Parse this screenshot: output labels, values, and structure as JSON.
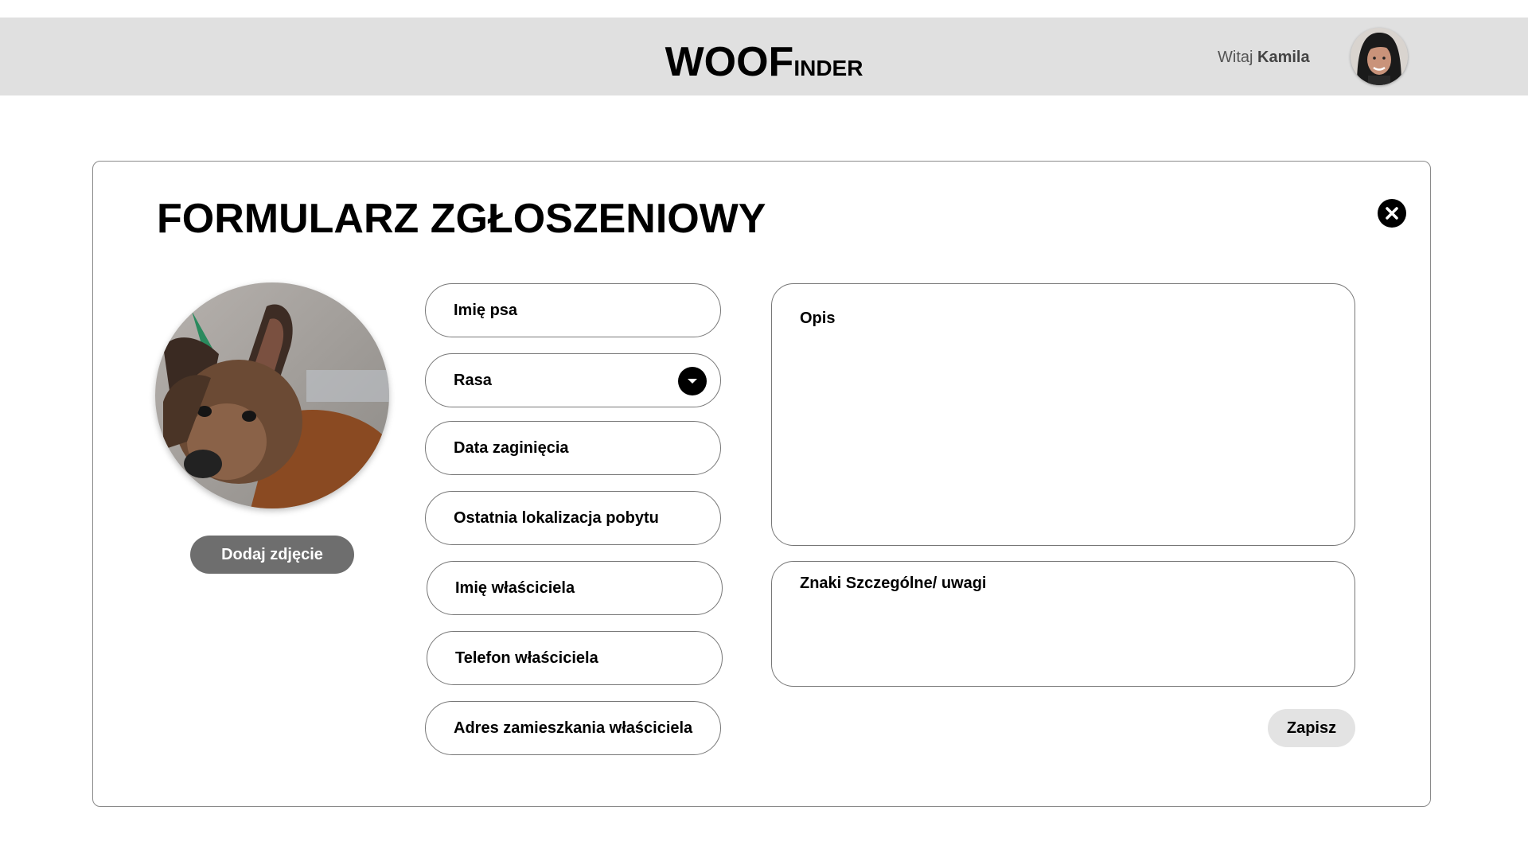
{
  "header": {
    "logo_main": "WOOF",
    "logo_rest": "INDER",
    "greeting_prefix": "Witaj",
    "user_name": "Kamila",
    "avatar_icon": "user-avatar-photo"
  },
  "form": {
    "title": "FORMULARZ ZGŁOSZENIOWY",
    "close_icon": "close-icon",
    "photo_icon": "dog-photo",
    "add_photo_label": "Dodaj zdjęcie",
    "fields": {
      "dog_name": "Imię psa",
      "breed": "Rasa",
      "missing_date": "Data zaginięcia",
      "last_location": "Ostatnia lokalizacja pobytu",
      "owner_name": "Imię właściciela",
      "owner_phone": "Telefon właściciela",
      "owner_address": "Adres zamieszkania właściciela"
    },
    "description_label": "Opis",
    "remarks_label": "Znaki Szczególne/ uwagi",
    "save_label": "Zapisz"
  },
  "colors": {
    "header_bg": "#e0e0e0",
    "add_photo_bg": "#6e6e6e",
    "save_bg": "#e3e3e3",
    "border": "#777777"
  }
}
